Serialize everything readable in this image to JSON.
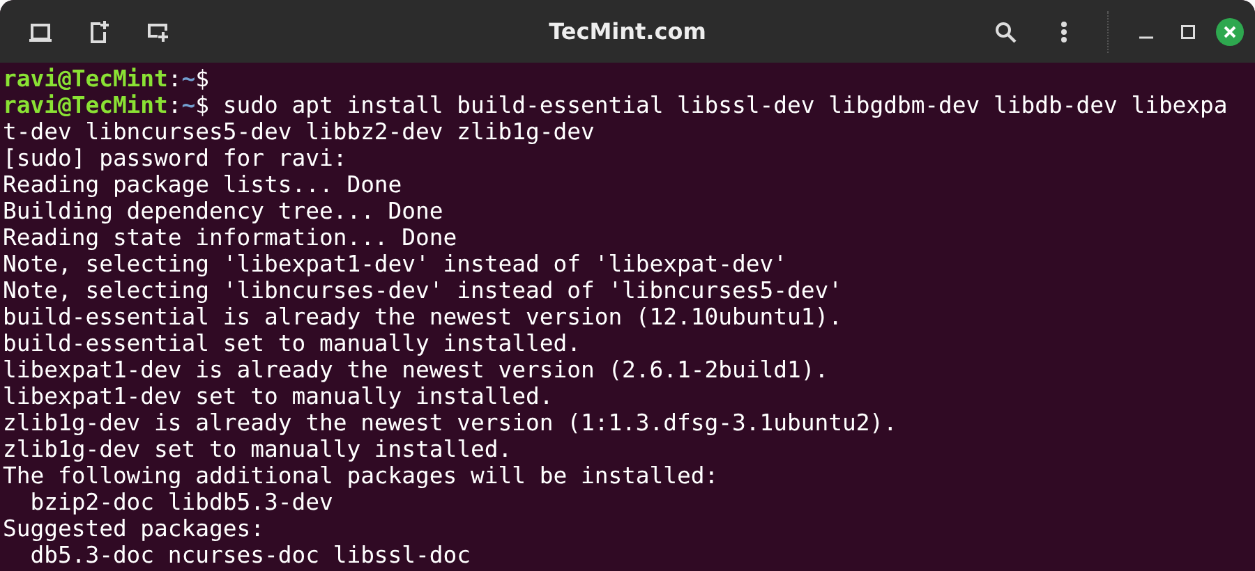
{
  "window": {
    "title": "TecMint.com"
  },
  "lines": [
    {
      "kind": "prompt",
      "user_host": "ravi@TecMint",
      "separator": ":",
      "path": "~",
      "symbol": "$"
    },
    {
      "kind": "prompt",
      "user_host": "ravi@TecMint",
      "separator": ":",
      "path": "~",
      "symbol": "$",
      "command": " sudo apt install build-essential libssl-dev libgdbm-dev libdb-dev libexpa"
    },
    {
      "kind": "output",
      "text": "t-dev libncurses5-dev libbz2-dev zlib1g-dev"
    },
    {
      "kind": "output",
      "text": "[sudo] password for ravi:"
    },
    {
      "kind": "output",
      "text": "Reading package lists... Done"
    },
    {
      "kind": "output",
      "text": "Building dependency tree... Done"
    },
    {
      "kind": "output",
      "text": "Reading state information... Done"
    },
    {
      "kind": "output",
      "text": "Note, selecting 'libexpat1-dev' instead of 'libexpat-dev'"
    },
    {
      "kind": "output",
      "text": "Note, selecting 'libncurses-dev' instead of 'libncurses5-dev'"
    },
    {
      "kind": "output",
      "text": "build-essential is already the newest version (12.10ubuntu1)."
    },
    {
      "kind": "output",
      "text": "build-essential set to manually installed."
    },
    {
      "kind": "output",
      "text": "libexpat1-dev is already the newest version (2.6.1-2build1)."
    },
    {
      "kind": "output",
      "text": "libexpat1-dev set to manually installed."
    },
    {
      "kind": "output",
      "text": "zlib1g-dev is already the newest version (1:1.3.dfsg-3.1ubuntu2)."
    },
    {
      "kind": "output",
      "text": "zlib1g-dev set to manually installed."
    },
    {
      "kind": "output",
      "text": "The following additional packages will be installed:"
    },
    {
      "kind": "output",
      "text": "  bzip2-doc libdb5.3-dev"
    },
    {
      "kind": "output",
      "text": "Suggested packages:"
    },
    {
      "kind": "output",
      "text": "  db5.3-doc ncurses-doc libssl-doc"
    }
  ]
}
